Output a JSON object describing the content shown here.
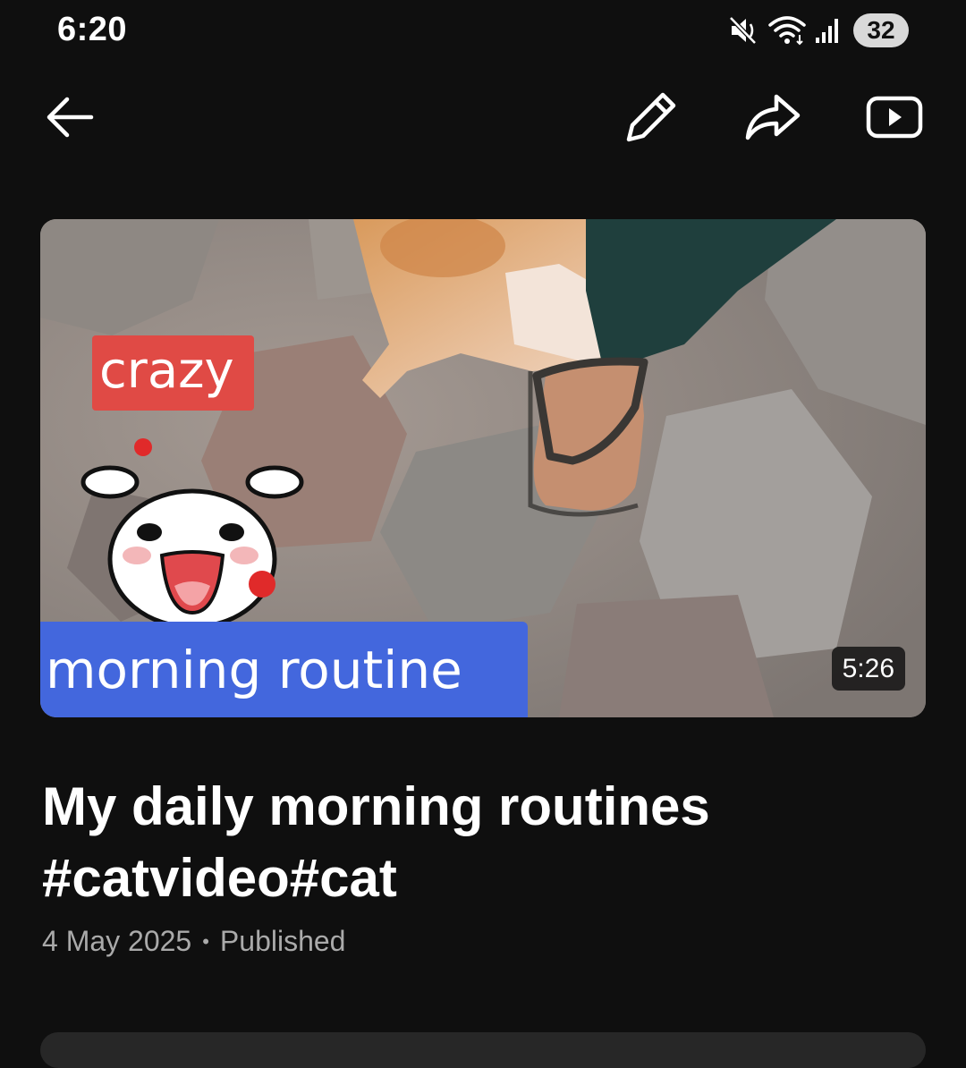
{
  "status_bar": {
    "time": "6:20",
    "battery": "32",
    "icons": [
      "mute-icon",
      "wifi-icon",
      "signal-icon",
      "battery-icon"
    ]
  },
  "app_bar": {
    "icons": [
      "back-arrow-icon",
      "edit-pencil-icon",
      "share-icon",
      "play-video-icon"
    ]
  },
  "video": {
    "thumbnail_caption_top": "crazy",
    "thumbnail_caption_bottom": "morning routine",
    "duration": "5:26",
    "title": "My daily morning routines #catvideo#cat",
    "date": "4 May 2025",
    "separator": "•",
    "status": "Published"
  },
  "colors": {
    "background": "#0f0f0f",
    "caption_top_bg": "#e04a45",
    "caption_bottom_bg": "#4367dd",
    "meta_text": "#aaaaaa"
  }
}
